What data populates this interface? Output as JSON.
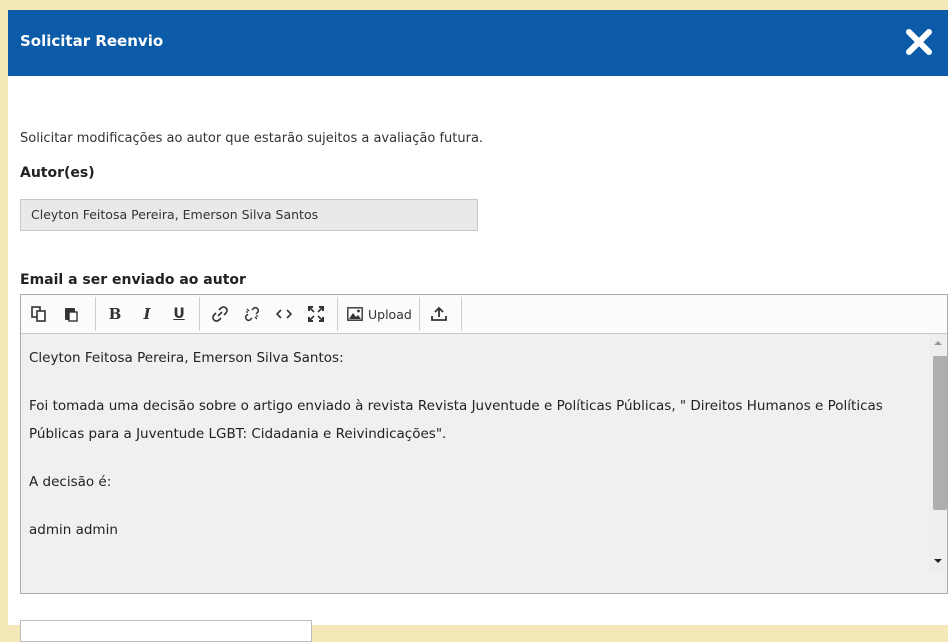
{
  "dialog": {
    "title": "Solicitar Reenvio",
    "close_icon": "close-icon"
  },
  "intro_text": "Solicitar modificações ao autor que estarão sujeitos a avaliação futura.",
  "authors": {
    "label": "Autor(es)",
    "value": "Cleyton Feitosa Pereira, Emerson Silva Santos"
  },
  "email": {
    "label": "Email a ser enviado ao autor",
    "toolbar": {
      "buttons": [
        "copy-icon",
        "paste-icon",
        "bold-icon",
        "italic-icon",
        "underline-icon",
        "link-icon",
        "unlink-icon",
        "code-icon",
        "fullscreen-icon",
        "image-icon",
        "upload-icon"
      ],
      "upload_label": "Upload"
    },
    "body": {
      "greeting": "Cleyton Feitosa Pereira, Emerson Silva Santos:",
      "paragraph": "Foi tomada uma decisão sobre o artigo enviado à revista Revista Juventude e Políticas Públicas, \" Direitos Humanos e Políticas Públicas para a Juventude LGBT: Cidadania e Reivindicações\".",
      "decision": "A decisão é:",
      "signature": "admin admin"
    }
  },
  "colors": {
    "header_bg": "#0b5ba8",
    "page_bg": "#f5e8b8"
  }
}
